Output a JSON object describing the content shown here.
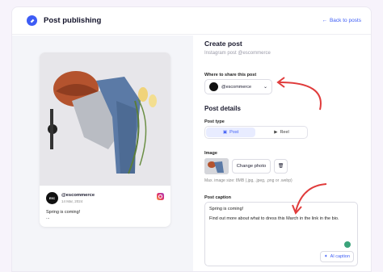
{
  "app": {
    "title": "Post publishing",
    "back_label": "Back to posts"
  },
  "preview": {
    "account": "@escommerce",
    "date": "14 Mar, 2024",
    "caption": "Spring is coming!",
    "ellipsis": "...",
    "avatar_text": "ESC"
  },
  "form": {
    "title": "Create post",
    "subtitle": "Instagram post @escommerce",
    "share_label": "Where to share this post",
    "account_selected": "@escommerce",
    "details_title": "Post details",
    "type_label": "Post type",
    "types": [
      {
        "label": "Post",
        "active": true
      },
      {
        "label": "Reel",
        "active": false
      }
    ],
    "image_label": "Image",
    "change_photo": "Change photo",
    "image_hint": "Max. image size: 8MB (.jpg, .jpeg, .png or .webp)",
    "caption_label": "Post caption",
    "caption_line1": "Spring is coming!",
    "caption_line2": "Find out more about what to dress this March in the link in the bio.",
    "ai_label": "AI caption"
  },
  "colors": {
    "accent": "#3d5cf5",
    "arrow": "#e03b3b"
  }
}
